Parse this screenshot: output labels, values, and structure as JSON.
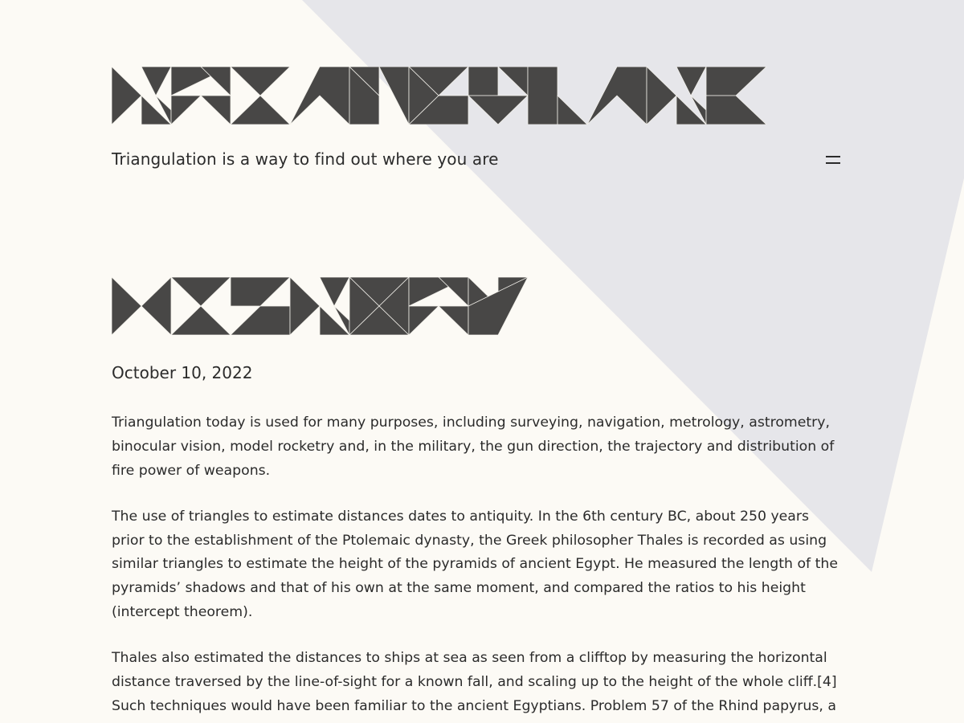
{
  "site": {
    "title": "TRIANGULATE",
    "tagline": "Triangulation is a way to find out where you are",
    "menu_icon": "menu-icon"
  },
  "post": {
    "title": "HISTORY",
    "date": "October 10, 2022",
    "paragraphs": [
      "Triangulation today is used for many purposes, including surveying, navigation, metrology, astrometry, binocular vision, model rocketry and, in the military, the gun direction, the trajectory and distribution of fire power of weapons.",
      "The use of triangles to estimate distances dates to antiquity. In the 6th century BC, about 250 years prior to the establishment of the Ptolemaic dynasty, the Greek philosopher Thales is recorded as using similar triangles to estimate the height of the pyramids of ancient Egypt. He measured the length of the pyramids’ shadows and that of his own at the same moment, and compared the ratios to his height (intercept theorem).",
      "Thales also estimated the distances to ships at sea as seen from a clifftop by measuring the horizontal distance traversed by the line-of-sight for a known fall, and scaling up to the height of the whole cliff.[4] Such techniques would have been familiar to the ancient Egyptians. Problem 57 of the Rhind papyrus, a"
    ]
  },
  "colors": {
    "background": "#fcfaf5",
    "shape": "#e6e6ea",
    "text": "#2b2b2b",
    "glyph": "#484746"
  }
}
